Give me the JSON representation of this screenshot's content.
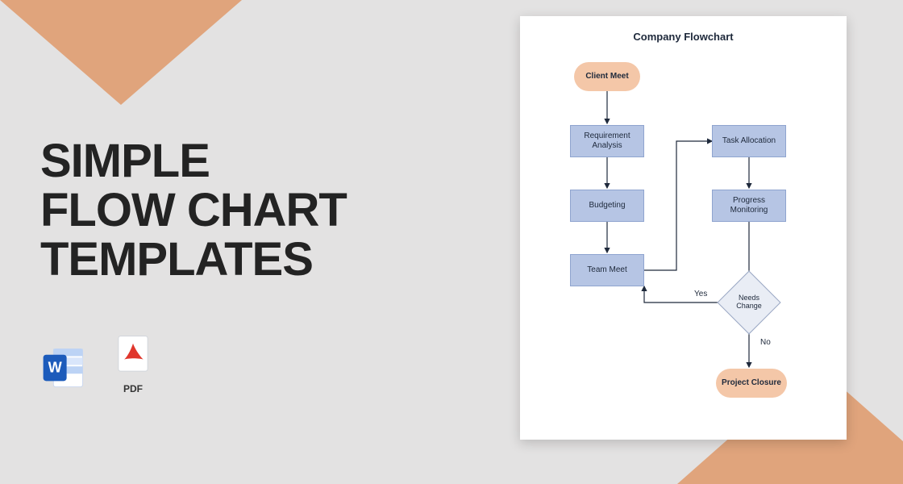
{
  "headline": {
    "line1": "SIMPLE",
    "line2": "FLOW CHART",
    "line3": "TEMPLATES"
  },
  "formats": {
    "word_label": "",
    "pdf_label": "PDF"
  },
  "flowchart": {
    "title": "Company Flowchart",
    "nodes": {
      "client_meet": "Client Meet",
      "requirement_analysis": "Requirement Analysis",
      "budgeting": "Budgeting",
      "team_meet": "Team Meet",
      "task_allocation": "Task Allocation",
      "progress_monitoring": "Progress Monitoring",
      "needs_change": "Needs Change",
      "project_closure": "Project Closure"
    },
    "decision_labels": {
      "yes": "Yes",
      "no": "No"
    }
  }
}
